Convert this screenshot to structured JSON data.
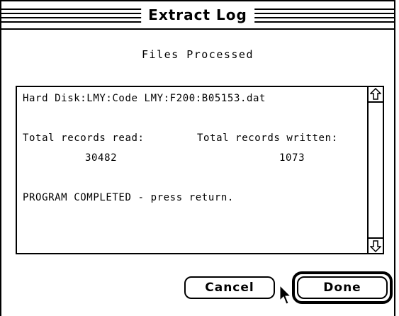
{
  "window": {
    "title": "Extract Log"
  },
  "dialog": {
    "heading": "Files Processed",
    "log": {
      "path": "Hard Disk:LMY:Code LMY:F200:B05153.dat",
      "read_label": "Total records read:",
      "written_label": "Total records written:",
      "read_value": "30482",
      "written_value": "1073",
      "status": "PROGRAM COMPLETED - press return."
    }
  },
  "buttons": {
    "cancel": "Cancel",
    "done": "Done"
  },
  "icons": {
    "scroll_up": "up-arrow-icon",
    "scroll_down": "down-arrow-icon",
    "pointer": "mouse-pointer-icon"
  }
}
